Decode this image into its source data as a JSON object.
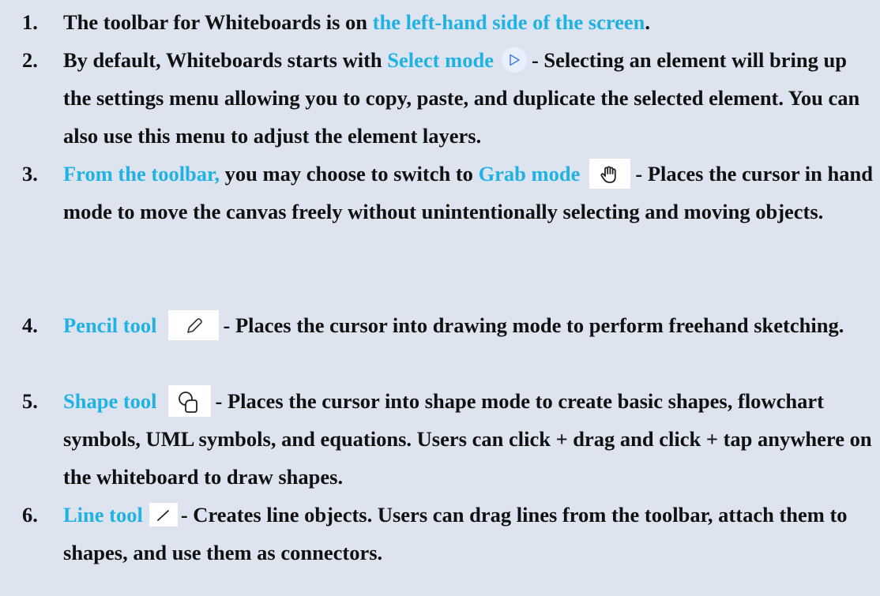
{
  "steps": [
    {
      "num": "1.",
      "before": "The toolbar for Whiteboards is on ",
      "highlight": "the left-hand side of the screen",
      "after": "."
    },
    {
      "num": "2.",
      "before": "By default, Whiteboards starts with ",
      "highlight": "Select mode",
      "icon": "cursor-arrow-icon",
      "after": "- Selecting an element will bring up the settings menu allowing you to copy, paste, and duplicate the selected element. You can also use this menu to adjust the element layers."
    },
    {
      "num": "3.",
      "highlight_pre": "From the toolbar,",
      "before": " you may choose to switch to ",
      "highlight": "Grab mode",
      "icon": "hand-icon",
      "after": "- Places the cursor in hand mode to move the canvas freely without unintentionally selecting and moving objects."
    },
    {
      "num": "4.",
      "highlight": "Pencil tool",
      "icon": "pencil-icon",
      "after": "- Places the cursor into drawing mode to perform freehand sketching."
    },
    {
      "num": "5.",
      "highlight": "Shape tool",
      "icon": "shapes-icon",
      "after": "- Places the cursor into shape mode to create basic shapes, flowchart symbols, UML symbols, and equations. Users can click + drag and click + tap anywhere on the whiteboard to draw shapes."
    },
    {
      "num": "6.",
      "highlight": "Line tool",
      "icon": "line-icon",
      "after": "- Creates line objects. Users can drag lines from the toolbar, attach them to shapes, and use them as connectors."
    }
  ],
  "colors": {
    "background": "#dde4f0",
    "text": "#111111",
    "highlight": "#1fb2e3",
    "icon_stroke": "#3a7bf0"
  }
}
